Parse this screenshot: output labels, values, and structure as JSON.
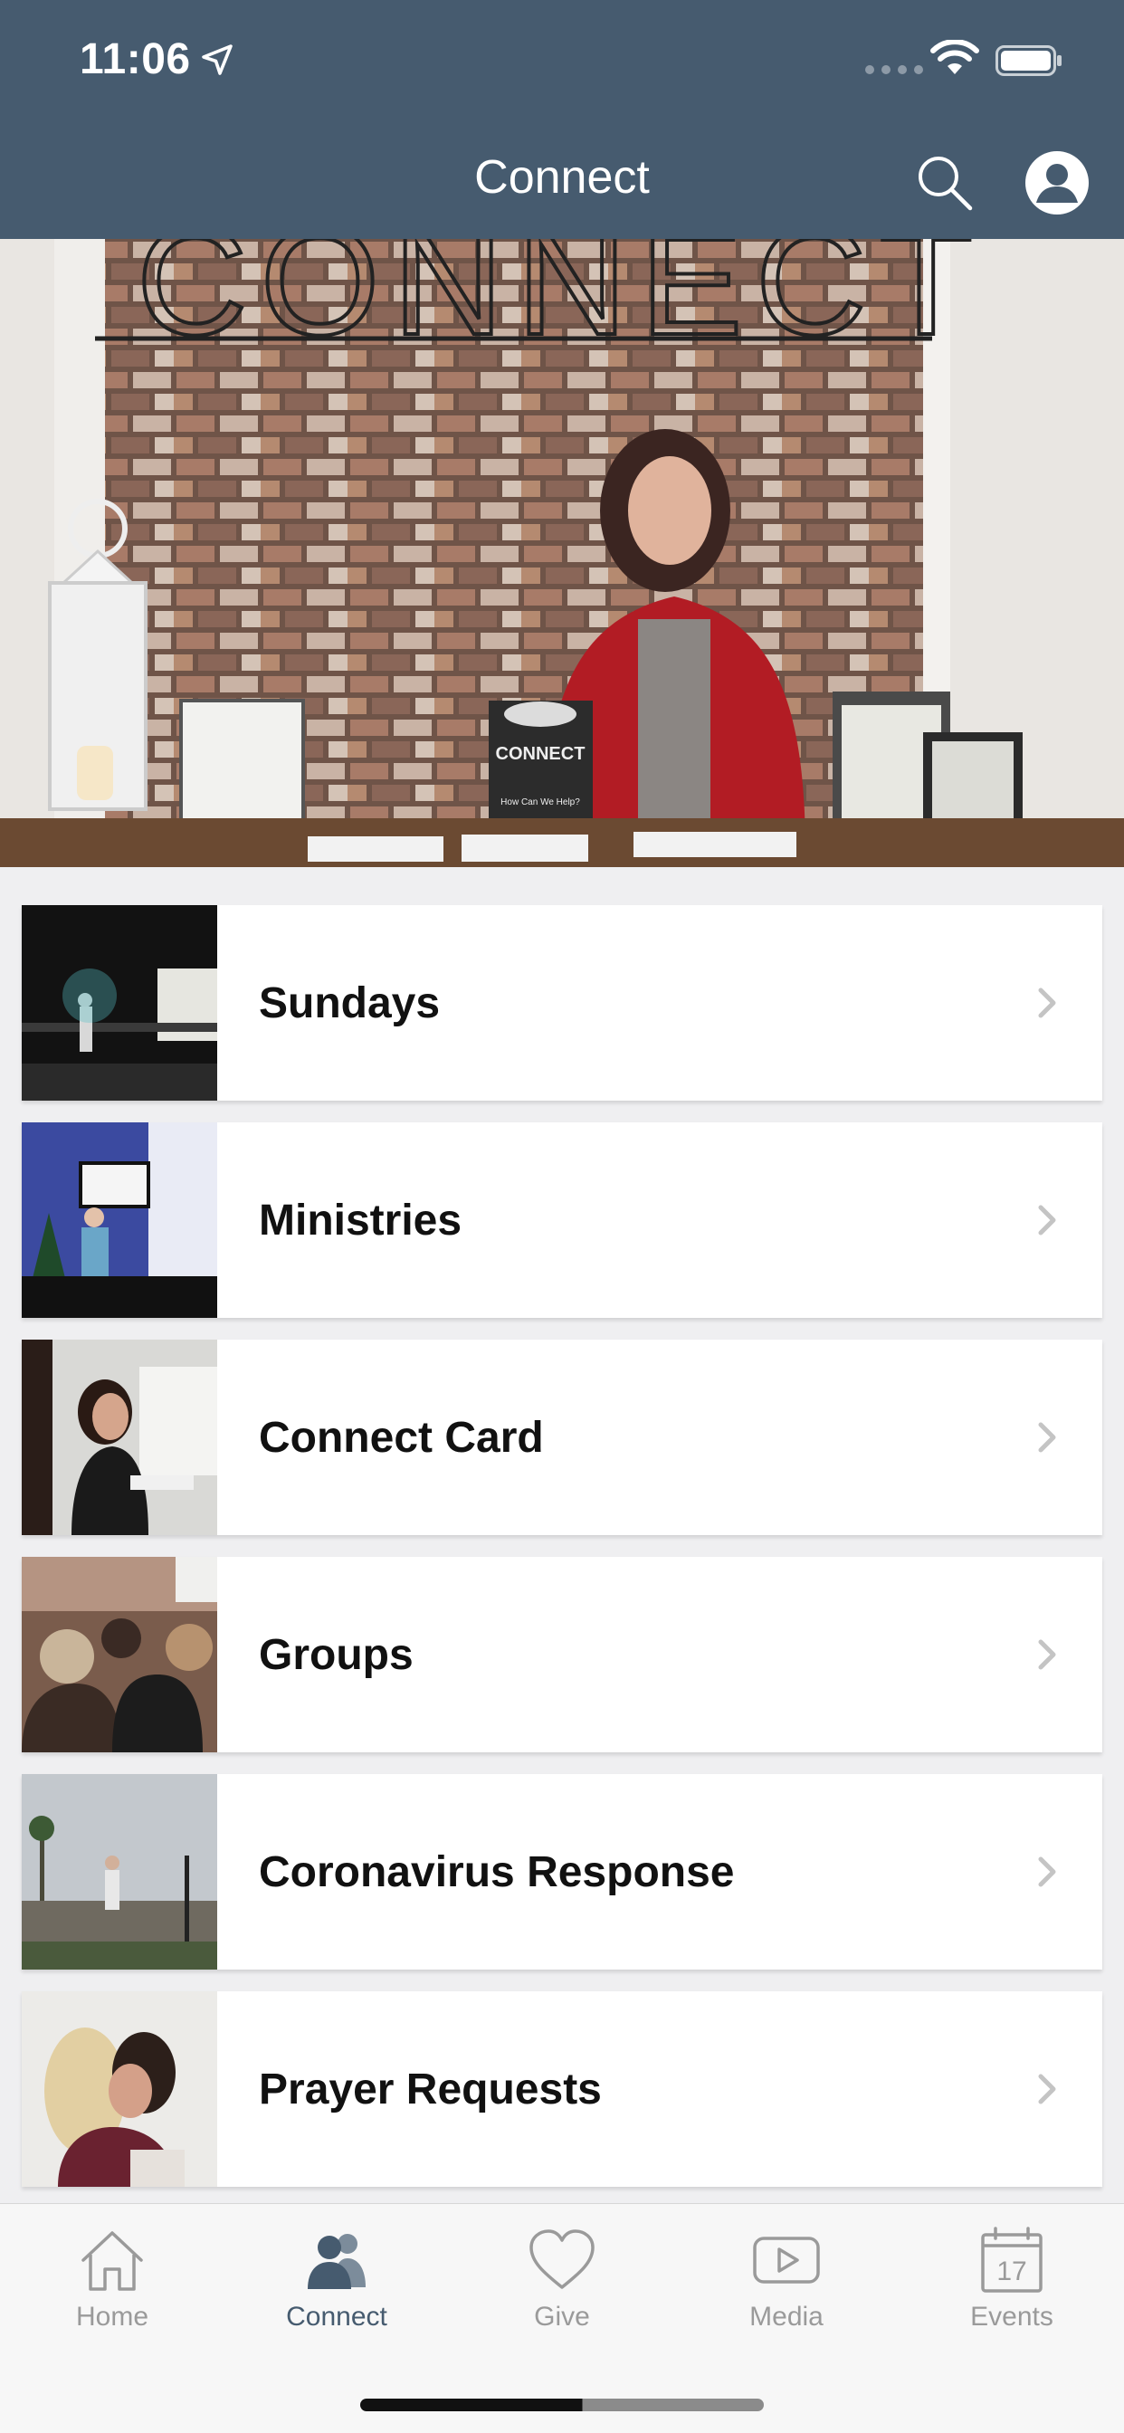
{
  "status_bar": {
    "time": "11:06",
    "location_icon": "location-arrow-icon",
    "wifi_icon": "wifi-icon",
    "battery_icon": "battery-icon"
  },
  "header": {
    "title": "Connect",
    "search_icon": "search-icon",
    "profile_icon": "profile-icon"
  },
  "hero": {
    "sign_text": "CONNECT",
    "booklet_text": "CONNECT",
    "booklet_subtext": "How Can We Help?"
  },
  "colors": {
    "header_bg": "#465b6f",
    "accent": "#465b6f",
    "tab_inactive": "#9a9a9a"
  },
  "menu": {
    "items": [
      {
        "label": "Sundays",
        "icon": "chevron-right-icon"
      },
      {
        "label": "Ministries",
        "icon": "chevron-right-icon"
      },
      {
        "label": "Connect Card",
        "icon": "chevron-right-icon"
      },
      {
        "label": "Groups",
        "icon": "chevron-right-icon"
      },
      {
        "label": "Coronavirus Response",
        "icon": "chevron-right-icon"
      },
      {
        "label": "Prayer Requests",
        "icon": "chevron-right-icon"
      }
    ]
  },
  "tabbar": {
    "tabs": [
      {
        "label": "Home",
        "icon": "home-icon",
        "active": false
      },
      {
        "label": "Connect",
        "icon": "people-icon",
        "active": true
      },
      {
        "label": "Give",
        "icon": "heart-icon",
        "active": false
      },
      {
        "label": "Media",
        "icon": "play-icon",
        "active": false
      },
      {
        "label": "Events",
        "icon": "calendar-icon",
        "active": false,
        "calendar_day": "17"
      }
    ]
  }
}
